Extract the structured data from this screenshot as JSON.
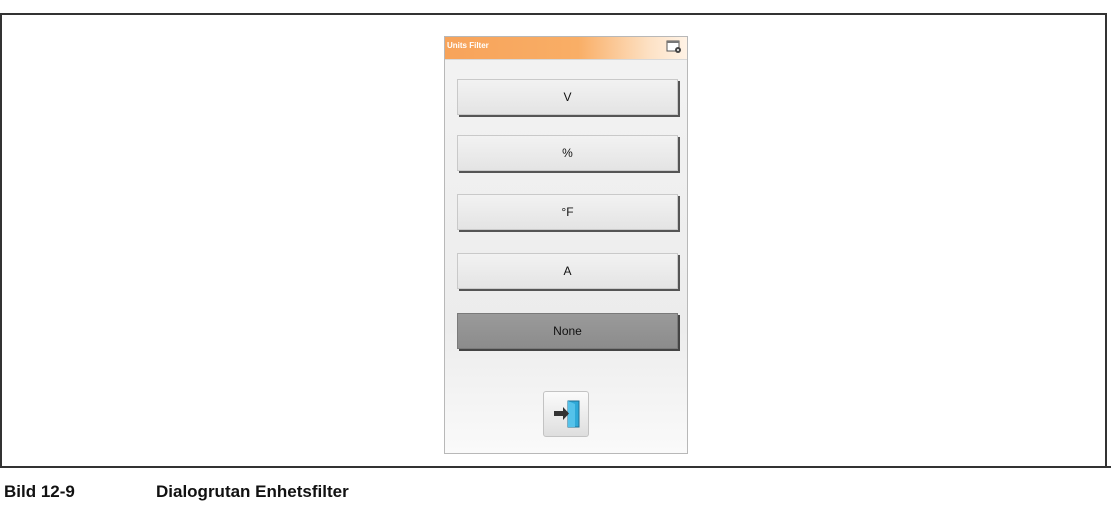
{
  "dialog": {
    "title": "Units Filter",
    "title_icon": "window-settings-icon",
    "accent_color": "#f7a35a",
    "buttons": [
      {
        "label": "V"
      },
      {
        "label": "%"
      },
      {
        "label": "°F"
      },
      {
        "label": "A"
      },
      {
        "label": "None",
        "selected": true
      }
    ],
    "exit_icon": "exit-door-icon"
  },
  "caption": {
    "label": "Bild 12-9",
    "title": "Dialogrutan Enhetsfilter"
  }
}
